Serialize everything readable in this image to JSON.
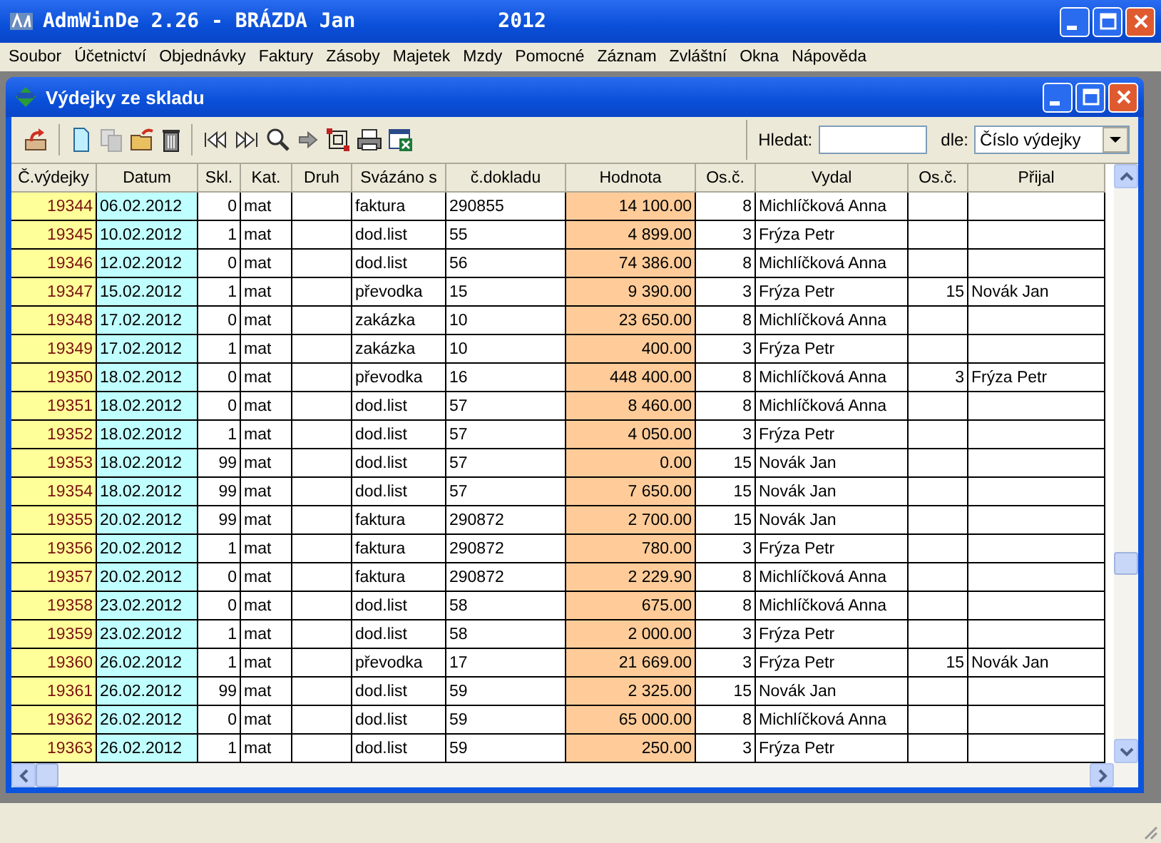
{
  "window": {
    "title": "AdmWinDe 2.26 - BRÁZDA Jan",
    "year": "2012"
  },
  "menu": [
    "Soubor",
    "Účetnictví",
    "Objednávky",
    "Faktury",
    "Zásoby",
    "Majetek",
    "Mzdy",
    "Pomocné",
    "Záznam",
    "Zvláštní",
    "Okna",
    "Nápověda"
  ],
  "child_window": {
    "title": "Výdejky ze skladu"
  },
  "search": {
    "label": "Hledat:",
    "by_label": "dle:",
    "by_value": "Číslo výdejky"
  },
  "table": {
    "columns": [
      {
        "label": "Č.výdejky",
        "kind": "number",
        "color": "#ffff99"
      },
      {
        "label": "Datum",
        "kind": "text",
        "color": "#c0ffff"
      },
      {
        "label": "Skl.",
        "kind": "number",
        "color": "#ffffff"
      },
      {
        "label": "Kat.",
        "kind": "text",
        "color": "#ffffff"
      },
      {
        "label": "Druh",
        "kind": "text",
        "color": "#ffffff"
      },
      {
        "label": "Svázáno s",
        "kind": "text",
        "color": "#ffffff"
      },
      {
        "label": "č.dokladu",
        "kind": "text",
        "color": "#ffffff"
      },
      {
        "label": "Hodnota",
        "kind": "number",
        "color": "#ffcc99"
      },
      {
        "label": "Os.č.",
        "kind": "number",
        "color": "#ffffff"
      },
      {
        "label": "Vydal",
        "kind": "text",
        "color": "#ffffff"
      },
      {
        "label": "Os.č.",
        "kind": "number",
        "color": "#ffffff"
      },
      {
        "label": "Přijal",
        "kind": "text",
        "color": "#ffffff"
      }
    ],
    "rows": [
      [
        "19344",
        "06.02.2012",
        "0",
        "mat",
        null,
        "faktura",
        "290855",
        "14 100.00",
        "8",
        "Michlíčková Anna",
        null,
        null
      ],
      [
        "19345",
        "10.02.2012",
        "1",
        "mat",
        null,
        "dod.list",
        "55",
        "4 899.00",
        "3",
        "Frýza Petr",
        null,
        null
      ],
      [
        "19346",
        "12.02.2012",
        "0",
        "mat",
        null,
        "dod.list",
        "56",
        "74 386.00",
        "8",
        "Michlíčková Anna",
        null,
        null
      ],
      [
        "19347",
        "15.02.2012",
        "1",
        "mat",
        null,
        "převodka",
        "15",
        "9 390.00",
        "3",
        "Frýza Petr",
        "15",
        "Novák Jan"
      ],
      [
        "19348",
        "17.02.2012",
        "0",
        "mat",
        null,
        "zakázka",
        "10",
        "23 650.00",
        "8",
        "Michlíčková Anna",
        null,
        null
      ],
      [
        "19349",
        "17.02.2012",
        "1",
        "mat",
        null,
        "zakázka",
        "10",
        "400.00",
        "3",
        "Frýza Petr",
        null,
        null
      ],
      [
        "19350",
        "18.02.2012",
        "0",
        "mat",
        null,
        "převodka",
        "16",
        "448 400.00",
        "8",
        "Michlíčková Anna",
        "3",
        "Frýza Petr"
      ],
      [
        "19351",
        "18.02.2012",
        "0",
        "mat",
        null,
        "dod.list",
        "57",
        "8 460.00",
        "8",
        "Michlíčková Anna",
        null,
        null
      ],
      [
        "19352",
        "18.02.2012",
        "1",
        "mat",
        null,
        "dod.list",
        "57",
        "4 050.00",
        "3",
        "Frýza Petr",
        null,
        null
      ],
      [
        "19353",
        "18.02.2012",
        "99",
        "mat",
        null,
        "dod.list",
        "57",
        "0.00",
        "15",
        "Novák Jan",
        null,
        null
      ],
      [
        "19354",
        "18.02.2012",
        "99",
        "mat",
        null,
        "dod.list",
        "57",
        "7 650.00",
        "15",
        "Novák Jan",
        null,
        null
      ],
      [
        "19355",
        "20.02.2012",
        "99",
        "mat",
        null,
        "faktura",
        "290872",
        "2 700.00",
        "15",
        "Novák Jan",
        null,
        null
      ],
      [
        "19356",
        "20.02.2012",
        "1",
        "mat",
        null,
        "faktura",
        "290872",
        "780.00",
        "3",
        "Frýza Petr",
        null,
        null
      ],
      [
        "19357",
        "20.02.2012",
        "0",
        "mat",
        null,
        "faktura",
        "290872",
        "2 229.90",
        "8",
        "Michlíčková Anna",
        null,
        null
      ],
      [
        "19358",
        "23.02.2012",
        "0",
        "mat",
        null,
        "dod.list",
        "58",
        "675.00",
        "8",
        "Michlíčková Anna",
        null,
        null
      ],
      [
        "19359",
        "23.02.2012",
        "1",
        "mat",
        null,
        "dod.list",
        "58",
        "2 000.00",
        "3",
        "Frýza Petr",
        null,
        null
      ],
      [
        "19360",
        "26.02.2012",
        "1",
        "mat",
        null,
        "převodka",
        "17",
        "21 669.00",
        "3",
        "Frýza Petr",
        "15",
        "Novák Jan"
      ],
      [
        "19361",
        "26.02.2012",
        "99",
        "mat",
        null,
        "dod.list",
        "59",
        "2 325.00",
        "15",
        "Novák Jan",
        null,
        null
      ],
      [
        "19362",
        "26.02.2012",
        "0",
        "mat",
        null,
        "dod.list",
        "59",
        "65 000.00",
        "8",
        "Michlíčková Anna",
        null,
        null
      ],
      [
        "19363",
        "26.02.2012",
        "1",
        "mat",
        null,
        "dod.list",
        "59",
        "250.00",
        "3",
        "Frýza Petr",
        null,
        null
      ]
    ]
  }
}
